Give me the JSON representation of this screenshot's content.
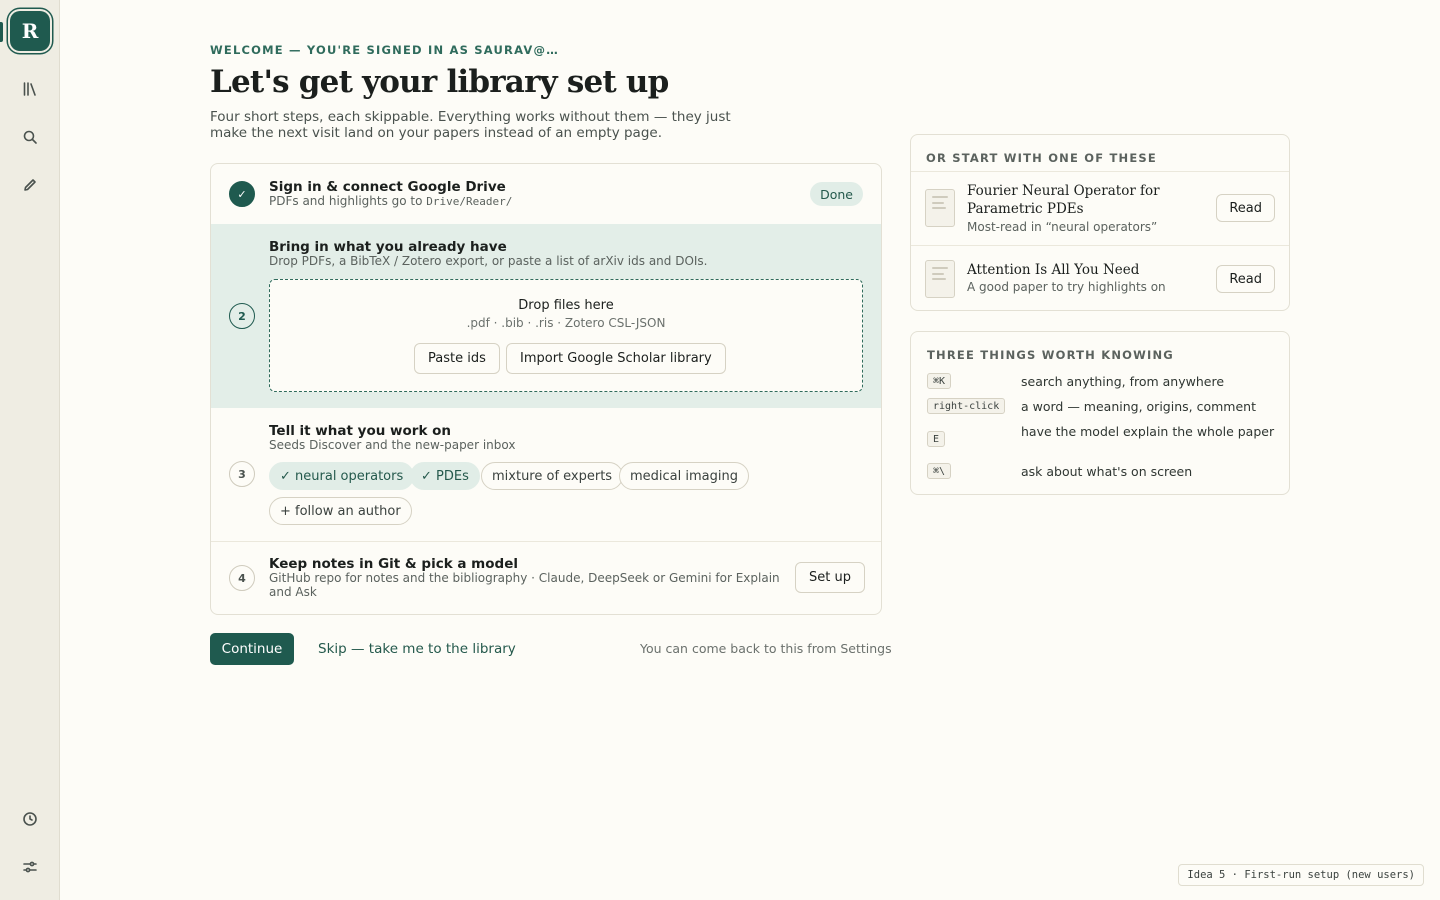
{
  "sidebar": {
    "logo_letter": "R",
    "items": [
      {
        "icon": "library-icon"
      },
      {
        "icon": "search-icon"
      },
      {
        "icon": "pencil-icon"
      },
      {
        "icon": "clock-icon"
      },
      {
        "icon": "settings-sliders-icon"
      }
    ]
  },
  "header": {
    "eyebrow": "WELCOME — YOU'RE SIGNED IN AS SAURAV@…",
    "title": "Let's get your library set up",
    "subtitle": "Four short steps, each skippable. Everything works without them — they just make the next visit land on your papers instead of an empty page."
  },
  "steps": [
    {
      "number": "✓",
      "title": "Sign in & connect Google Drive",
      "desc_prefix": "PDFs and highlights go to ",
      "desc_code": "Drive/Reader/",
      "status": "Done"
    },
    {
      "number": "2",
      "title": "Bring in what you already have",
      "desc": "Drop PDFs, a BibTeX / Zotero export, or paste a list of arXiv ids and DOIs.",
      "dropzone_title": "Drop files here",
      "dropzone_formats": ".pdf · .bib · .ris · Zotero CSL-JSON",
      "paste_label": "Paste ids",
      "import_label": "Import Google Scholar library"
    },
    {
      "number": "3",
      "title": "Tell it what you work on",
      "desc": "Seeds Discover and the new-paper inbox",
      "chips": [
        {
          "label": "✓ neural operators",
          "selected": true
        },
        {
          "label": "✓ PDEs",
          "selected": true
        },
        {
          "label": "mixture of experts",
          "selected": false
        },
        {
          "label": "medical imaging",
          "selected": false
        }
      ],
      "follow_label": "+ follow an author"
    },
    {
      "number": "4",
      "title": "Keep notes in Git & pick a model",
      "desc": "GitHub repo for notes and the bibliography · Claude, DeepSeek or Gemini for Explain and Ask",
      "action_label": "Set up"
    }
  ],
  "actions": {
    "continue_label": "Continue",
    "skip_label": "Skip — take me to the library",
    "settings_note": "You can come back to this from Settings"
  },
  "start_panel": {
    "heading": "OR START WITH ONE OF THESE",
    "papers": [
      {
        "title": "Fourier Neural Operator for Parametric PDEs",
        "subtitle": "Most-read in “neural operators”",
        "button": "Read"
      },
      {
        "title": "Attention Is All You Need",
        "subtitle": "A good paper to try highlights on",
        "button": "Read"
      }
    ]
  },
  "tips_panel": {
    "heading": "THREE THINGS WORTH KNOWING",
    "tips": [
      {
        "key": "⌘K",
        "text": "search anything, from anywhere"
      },
      {
        "key": "right-click",
        "text": "a word — meaning, origins, comment"
      },
      {
        "key": "E",
        "text": "have the model explain the whole paper"
      },
      {
        "key": "⌘\\",
        "text": "ask about what's on screen"
      }
    ]
  },
  "footer_tag": "Idea 5 · First-run setup (new users)",
  "colors": {
    "accent": "#1f5a4f",
    "accent_light": "#e1ede7",
    "background": "#fdfcf7",
    "sidebar": "#efede3"
  }
}
